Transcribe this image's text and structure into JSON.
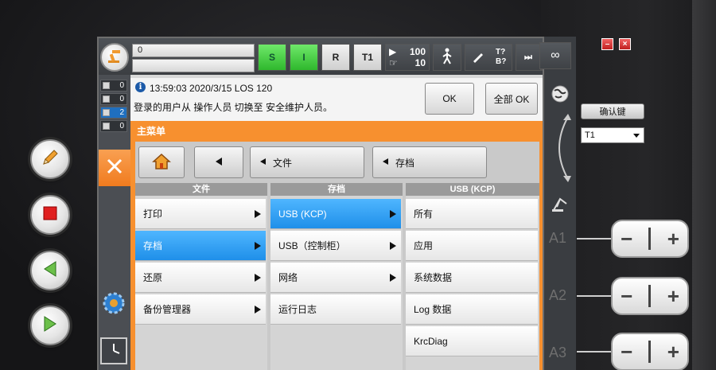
{
  "topbar": {
    "program_value": "0",
    "program_value2": "",
    "status_s": "S",
    "status_i": "I",
    "status_r": "R",
    "mode": "T1",
    "override_prog": "100",
    "override_jog": "10",
    "tool_label": "T?",
    "base_label": "B?",
    "infinity": "∞"
  },
  "messages": {
    "counters": [
      {
        "value": "0",
        "active": false
      },
      {
        "value": "0",
        "active": false
      },
      {
        "value": "2",
        "active": true
      },
      {
        "value": "0",
        "active": false
      }
    ],
    "time": "13:59:03 2020/3/15 LOS 120",
    "text": "登录的用户从 操作人员 切换至 安全维护人员。",
    "ok_label": "OK",
    "all_ok_label": "全部 OK"
  },
  "menu": {
    "title": "主菜单",
    "nav": {
      "home": "",
      "back": "",
      "crumb1": "文件",
      "crumb2": "存档"
    },
    "columns": [
      {
        "header": "文件",
        "items": [
          {
            "label": "打印",
            "arrow": true,
            "selected": false
          },
          {
            "label": "存档",
            "arrow": true,
            "selected": true
          },
          {
            "label": "还原",
            "arrow": true,
            "selected": false
          },
          {
            "label": "备份管理器",
            "arrow": true,
            "selected": false
          }
        ]
      },
      {
        "header": "存档",
        "items": [
          {
            "label": "USB (KCP)",
            "arrow": true,
            "selected": true
          },
          {
            "label": "USB（控制柜）",
            "arrow": true,
            "selected": false
          },
          {
            "label": "网络",
            "arrow": true,
            "selected": false
          },
          {
            "label": "运行日志",
            "arrow": false,
            "selected": false
          }
        ]
      },
      {
        "header": "USB (KCP)",
        "items": [
          {
            "label": "所有",
            "arrow": false,
            "selected": false
          },
          {
            "label": "应用",
            "arrow": false,
            "selected": false
          },
          {
            "label": "系统数据",
            "arrow": false,
            "selected": false
          },
          {
            "label": "Log 数据",
            "arrow": false,
            "selected": false
          },
          {
            "label": "KrcDiag",
            "arrow": false,
            "selected": false
          }
        ]
      }
    ]
  },
  "right": {
    "confirm_label": "确认键",
    "mode_value": "T1",
    "axes": [
      "A1",
      "A2",
      "A3"
    ],
    "minimize": "–",
    "close": "×"
  },
  "colors": {
    "accent_orange": "#f7902f",
    "selected_blue": "#1f8fe9",
    "status_green": "#2fb82d"
  }
}
